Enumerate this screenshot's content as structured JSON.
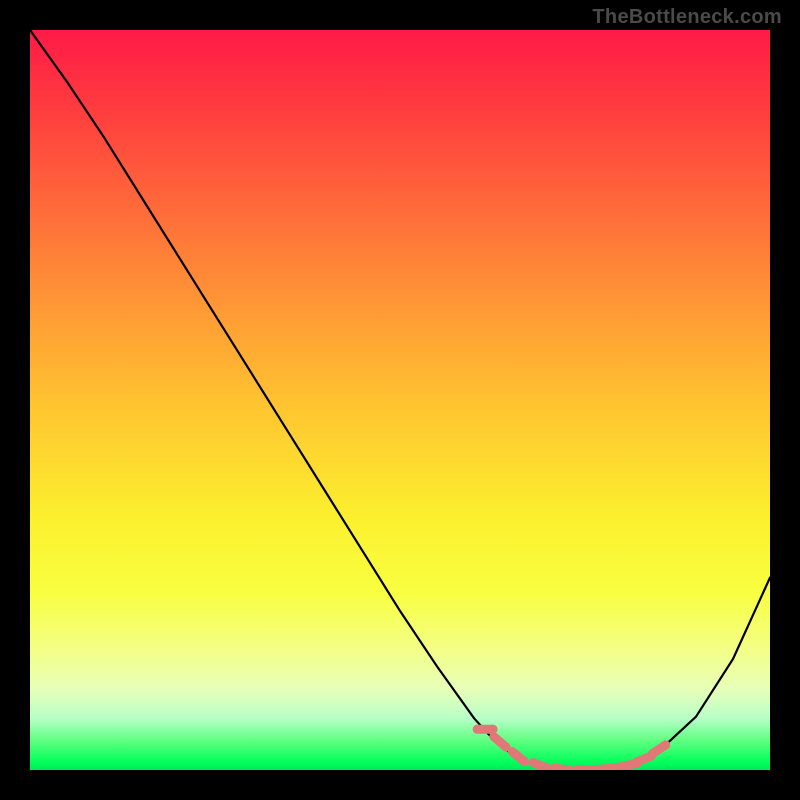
{
  "attribution": "TheBottleneck.com",
  "chart_data": {
    "type": "line",
    "title": "",
    "xlabel": "",
    "ylabel": "",
    "xlim": [
      0,
      100
    ],
    "ylim": [
      0,
      100
    ],
    "grid": false,
    "series": [
      {
        "name": "bottleneck-curve",
        "color": "#000000",
        "x": [
          0,
          5,
          10,
          15,
          20,
          25,
          30,
          35,
          40,
          45,
          50,
          55,
          60,
          62,
          65,
          68,
          70,
          72,
          75,
          78,
          80,
          83,
          86,
          90,
          95,
          100
        ],
        "y": [
          100,
          93,
          85.5,
          77.5,
          69.5,
          61.5,
          53.5,
          45.5,
          37.5,
          29.5,
          21.5,
          14.0,
          7.0,
          4.8,
          2.2,
          0.8,
          0.3,
          0.1,
          0.0,
          0.1,
          0.4,
          1.5,
          3.5,
          7.2,
          15.0,
          26.0
        ]
      },
      {
        "name": "highlight-dots",
        "color": "#e07878",
        "x": [
          61.5,
          63.5,
          66,
          69,
          72,
          75,
          77,
          79,
          81,
          83,
          85
        ],
        "y": [
          5.5,
          3.8,
          1.8,
          0.6,
          0.1,
          0.0,
          0.1,
          0.3,
          0.7,
          1.5,
          2.8
        ]
      }
    ],
    "background_gradient": {
      "type": "vertical",
      "stops": [
        {
          "pos": 0.0,
          "color": "#ff1a47"
        },
        {
          "pos": 0.24,
          "color": "#ff6a3a"
        },
        {
          "pos": 0.52,
          "color": "#ffc830"
        },
        {
          "pos": 0.76,
          "color": "#f8ff40"
        },
        {
          "pos": 0.93,
          "color": "#b8ffc8"
        },
        {
          "pos": 1.0,
          "color": "#00e85a"
        }
      ]
    }
  }
}
